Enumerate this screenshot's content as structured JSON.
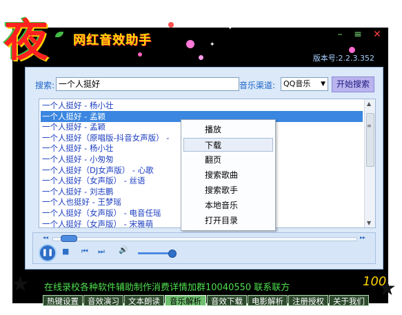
{
  "app": {
    "logo_char": "夜",
    "title": "网红音效助手",
    "version": "版本号:2.2.3.352",
    "window_buttons": {
      "minimize": "–",
      "menu": "≡",
      "close": "✕"
    }
  },
  "search": {
    "label": "搜索:",
    "value": "一个人挺好",
    "channel_label": "音乐渠道:",
    "channel_selected": "QQ音乐",
    "button": "开始搜索"
  },
  "results": [
    "一个人挺好 - 杨小壮",
    "一个人挺好 - 孟颖",
    "一个人挺好 - 孟颖",
    "一个人挺好（原唱版-抖音女声版） -",
    "一个人挺好 - 杨小壮",
    "一个人挺好 - 小匆匆",
    "一个人挺好（DJ女声版） - 心歌",
    "一个人挺好（女声版） - 丝语",
    "一个人挺好 - 刘志鹏",
    "一个人也挺好 - 王梦瑶",
    "一个人挺好（女声版） - 电音任瑶",
    "一个人挺好（女声版） - 宋雅萌"
  ],
  "selected_index": 1,
  "context_menu": [
    "播放",
    "下载",
    "翻页",
    "搜索歌曲",
    "搜索歌手",
    "本地音乐",
    "打开目录"
  ],
  "context_hover_index": 1,
  "player": {
    "seek_back": "◂◂",
    "seek_forward": "▸▸",
    "pause": "❚❚",
    "stop": "■",
    "prev": "⏮",
    "next": "⏭",
    "volume": "🔊"
  },
  "marquee": "在线录校各种软件辅助制作消费详情加群10040550 联系联方",
  "badge_100": "100",
  "tabs": [
    "热键设置",
    "音效演习",
    "文本朗读",
    "音乐解析",
    "音效下载",
    "电影解析",
    "注册授权",
    "关于我们"
  ],
  "active_tab": 3
}
